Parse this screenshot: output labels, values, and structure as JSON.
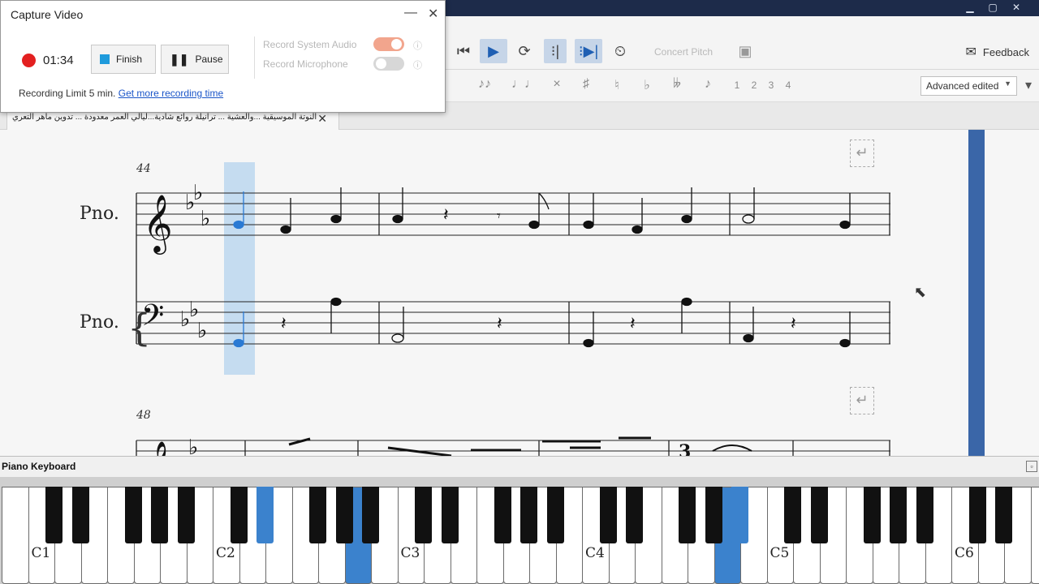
{
  "capture_dialog": {
    "title": "Capture Video",
    "timer": "01:34",
    "finish_label": "Finish",
    "pause_label": "Pause",
    "record_system_audio_label": "Record System Audio",
    "record_system_audio_on": true,
    "record_microphone_label": "Record Microphone",
    "record_microphone_on": false,
    "limit_text": "Recording Limit 5 min.",
    "limit_link": "Get more recording time",
    "minimize_glyph": "—",
    "close_glyph": "✕"
  },
  "toolbar": {
    "concert_pitch_label": "Concert Pitch",
    "feedback_label": "Feedback",
    "icons": [
      "rewind-icon",
      "play-icon",
      "loop-icon",
      "loop-in-icon",
      "loop-out-icon",
      "metronome-icon",
      "image-capture-icon",
      "feedback-mail-icon"
    ]
  },
  "palette": {
    "symbols": [
      "♪♪",
      "♩♩",
      "×",
      "♯",
      "♮",
      "♭",
      "𝄫",
      "♪"
    ],
    "voices": [
      "1",
      "2",
      "3",
      "4"
    ],
    "workspace_label": "Advanced edited"
  },
  "tab": {
    "title": "النوتة الموسيقية ...والعشية ... ترانيلة روائع شادية...ليالي العمر معدودة ... تدوين ماهر التعري",
    "close_glyph": "✕"
  },
  "score": {
    "system1_measure_number": "44",
    "system2_measure_number": "48",
    "instrument_upper": "Pno.",
    "instrument_lower": "Pno.",
    "return_glyph": "↵"
  },
  "keyboard": {
    "title": "Piano Keyboard",
    "pin_glyph": "▫",
    "octave_labels": [
      "C1",
      "C2",
      "C3",
      "C4",
      "C5",
      "C6"
    ],
    "pressed_notes": [
      "E♭2",
      "G2 area (C3 octave)",
      "E♭4 area",
      "E4"
    ]
  },
  "colors": {
    "accent": "#3b82cd",
    "selection": "#c5dcf0",
    "record": "#e32020",
    "toggle_on": "#f2a58d",
    "playline": "#3a66a8"
  }
}
